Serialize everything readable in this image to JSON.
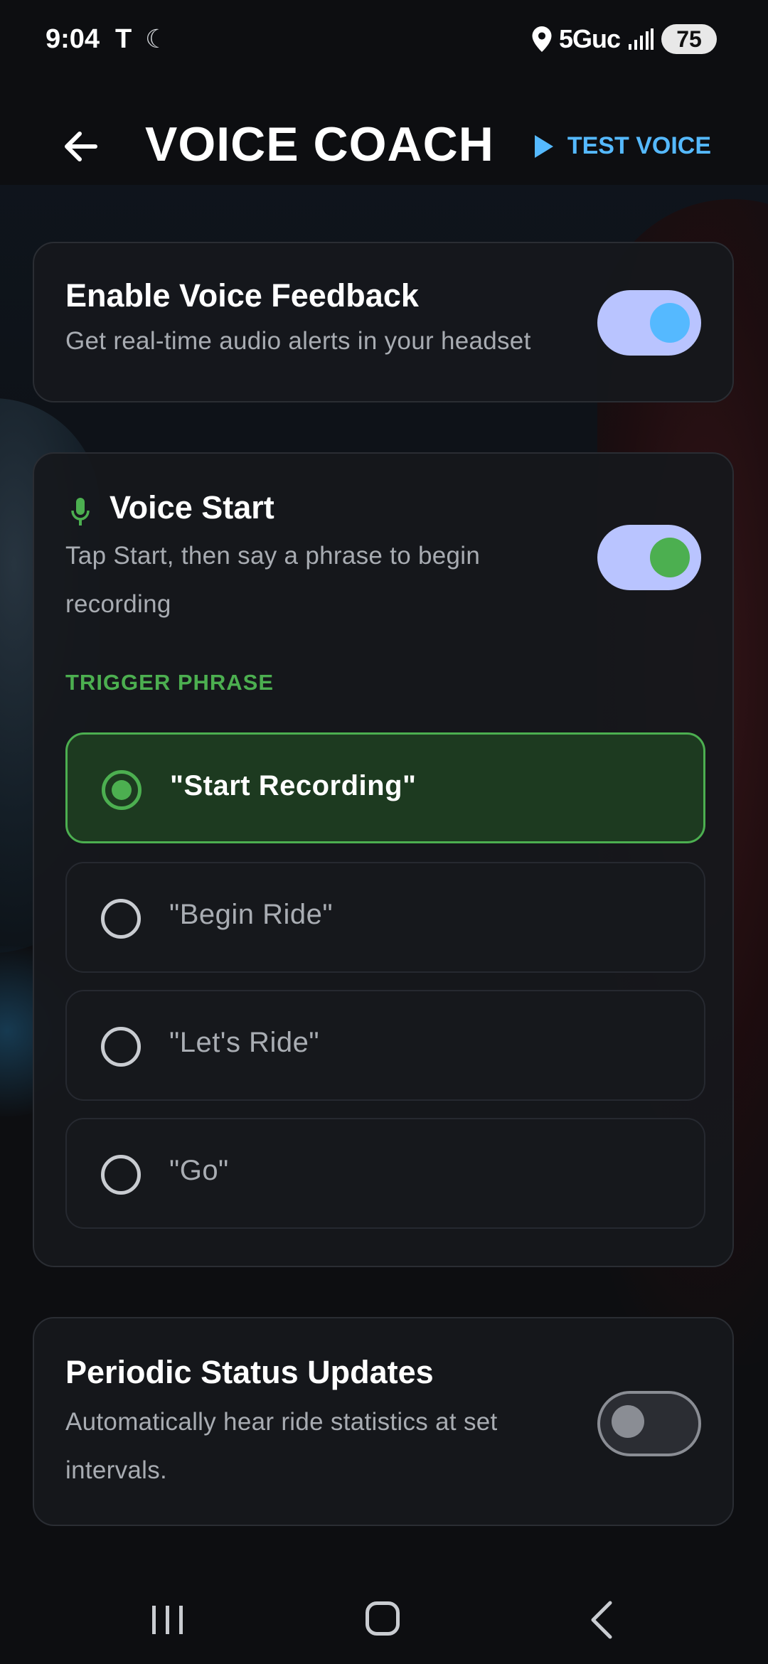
{
  "status_bar": {
    "time": "9:04",
    "carrier_letter": "T",
    "network": "5Guc",
    "battery": "75",
    "icons": [
      "location-pin-icon",
      "signal-bars-icon",
      "do-not-disturb-moon-icon"
    ]
  },
  "header": {
    "title": "VOICE COACH",
    "test_voice_label": "TEST VOICE",
    "back_icon": "arrow-left-icon",
    "play_icon": "play-triangle-icon"
  },
  "voice_feedback": {
    "title": "Enable Voice Feedback",
    "subtitle": "Get real-time audio alerts in your headset",
    "enabled": true,
    "knob_color": "#55b9ff"
  },
  "voice_start": {
    "title": "Voice Start",
    "subtitle_line1": "Tap Start, then say a phrase to begin",
    "subtitle_line2": "recording",
    "enabled": true,
    "knob_color": "#4caf50",
    "icon": "microphone-icon",
    "trigger_label": "TRIGGER PHRASE",
    "options": [
      {
        "label": "\"Start Recording\"",
        "selected": true
      },
      {
        "label": "\"Begin Ride\"",
        "selected": false
      },
      {
        "label": "\"Let's Ride\"",
        "selected": false
      },
      {
        "label": "\"Go\"",
        "selected": false
      }
    ]
  },
  "periodic_updates": {
    "title": "Periodic Status Updates",
    "subtitle_line1": "Automatically hear ride statistics at set",
    "subtitle_line2": "intervals.",
    "enabled": false
  },
  "nav_bar": {
    "icons": [
      "recent-apps-icon",
      "home-icon",
      "back-icon"
    ]
  },
  "colors": {
    "accent_blue": "#55b9ff",
    "accent_green": "#4caf50",
    "toggle_track_on": "#b9c4ff",
    "background": "#0d0e11"
  }
}
